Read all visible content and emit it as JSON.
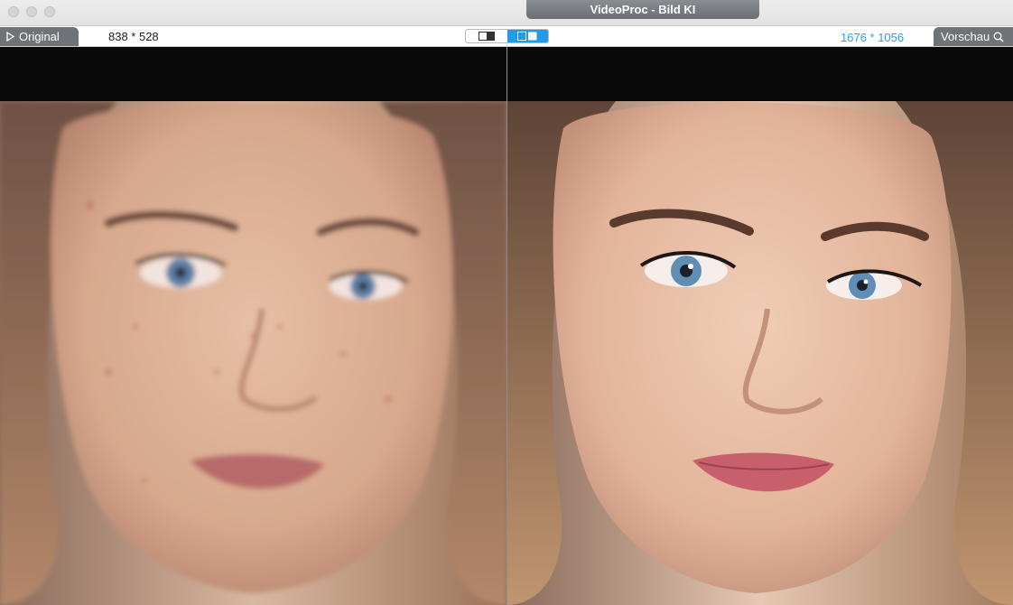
{
  "window": {
    "title": "VideoProc - Bild KI"
  },
  "toolbar": {
    "original_label": "Original",
    "original_resolution": "838 * 528",
    "preview_label": "Vorschau",
    "preview_resolution": "1676 * 1056",
    "view_modes": [
      "single-view",
      "side-by-side"
    ],
    "active_view_mode": "side-by-side",
    "accent_color": "#1f9be8"
  },
  "panels": {
    "left": {
      "content": "original-photo",
      "quality": "low-res blurry"
    },
    "right": {
      "content": "enhanced-photo",
      "quality": "upscaled sharp"
    }
  }
}
